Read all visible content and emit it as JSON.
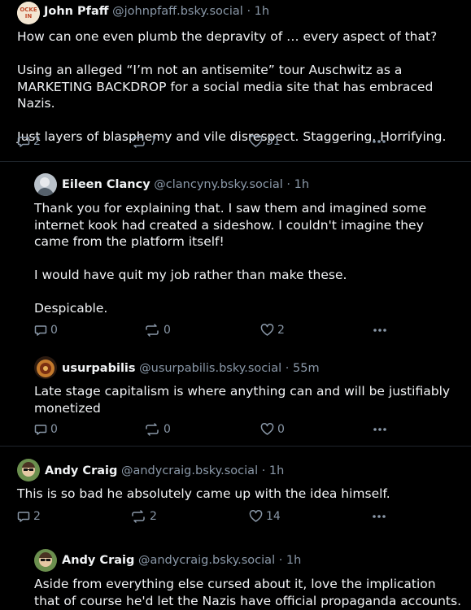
{
  "posts": [
    {
      "author": "John Pfaff",
      "handle": "@johnpfaff.bsky.social",
      "time": "· 1h",
      "text": "How can one even plumb the depravity of … every aspect of that?\n\nUsing an alleged “I’m not an antisemite” tour Auschwitz as a MARKETING BACKDROP for a social media site that has embraced Nazis.\n\nJust layers of blasphemy and vile disrespect. Staggering. Horrifying.",
      "replies": "2",
      "reposts": "7",
      "likes": "31",
      "avatar_text": "LOCKED\nIN"
    },
    {
      "author": "Eileen Clancy",
      "handle": "@clancyny.bsky.social",
      "time": "· 1h",
      "text": "Thank you for explaining that. I saw them and imagined some internet kook had created a sideshow. I couldn't imagine they came from the platform itself!\n\nI would have quit my job rather than make these.\n\nDespicable.",
      "replies": "0",
      "reposts": "0",
      "likes": "2"
    },
    {
      "author": "usurpabilis",
      "handle": "@usurpabilis.bsky.social",
      "time": "· 55m",
      "text": "Late stage capitalism is where anything can and will be justifiably monetized",
      "replies": "0",
      "reposts": "0",
      "likes": "0"
    },
    {
      "author": "Andy Craig",
      "handle": "@andycraig.bsky.social",
      "time": "· 1h",
      "text": "This is so bad he absolutely came up with the idea himself.",
      "replies": "2",
      "reposts": "2",
      "likes": "14"
    },
    {
      "author": "Andy Craig",
      "handle": "@andycraig.bsky.social",
      "time": "· 1h",
      "text": "Aside from everything else cursed about it, love the implication that of course he'd let the Nazis have official propaganda accounts.",
      "replies": "",
      "reposts": "",
      "likes": ""
    }
  ],
  "colors": {
    "background": "#000000",
    "text": "#f1f3f5",
    "muted": "#8a98a8",
    "divider": "#1f252c"
  },
  "icons": {
    "reply": "speech-bubble-icon",
    "repost": "repost-arrows-icon",
    "like": "heart-icon",
    "more": "ellipsis-icon"
  }
}
